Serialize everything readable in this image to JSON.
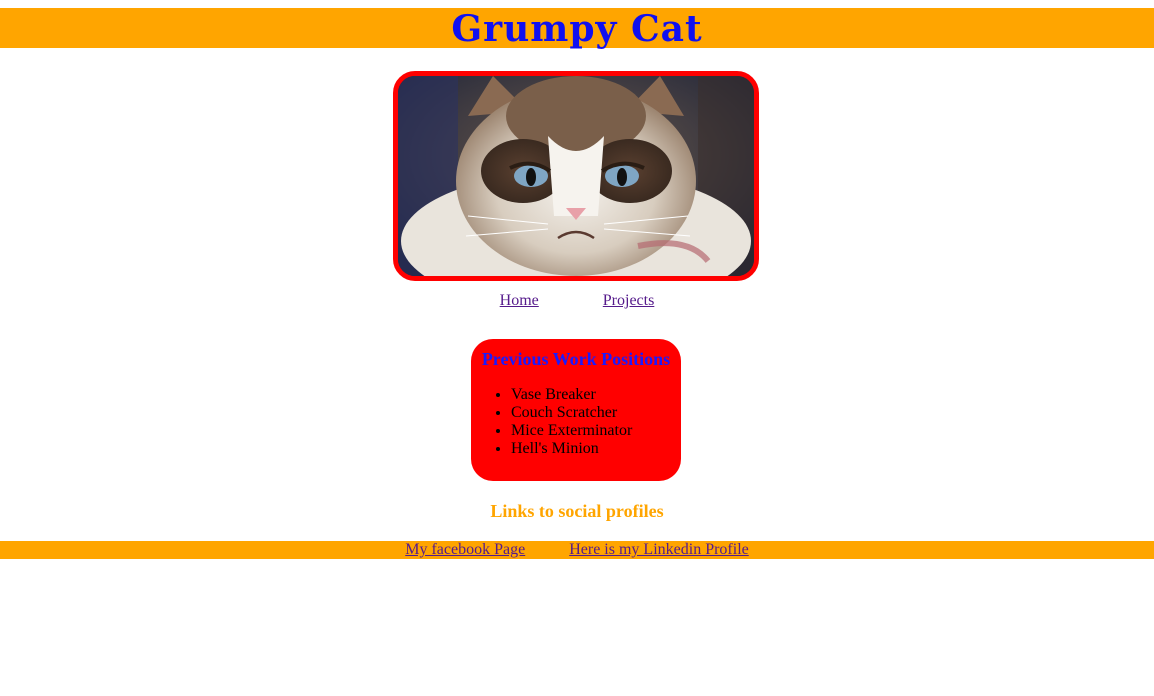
{
  "header": {
    "title": "Grumpy Cat"
  },
  "photo": {
    "alt": "Grumpy Cat photo"
  },
  "nav": {
    "home_label": "Home",
    "projects_label": "Projects"
  },
  "work": {
    "heading": "Previous Work Positions",
    "items": [
      "Vase Breaker",
      "Couch Scratcher",
      "Mice Exterminator",
      "Hell's Minion"
    ]
  },
  "social": {
    "heading": "Links to social profiles",
    "facebook_label": "My facebook Page",
    "linkedin_label": "Here is my Linkedin Profile"
  },
  "colors": {
    "banner": "#ffa500",
    "accent_red": "#ff0000",
    "title_blue": "#1010f0",
    "link": "#551a8b"
  }
}
